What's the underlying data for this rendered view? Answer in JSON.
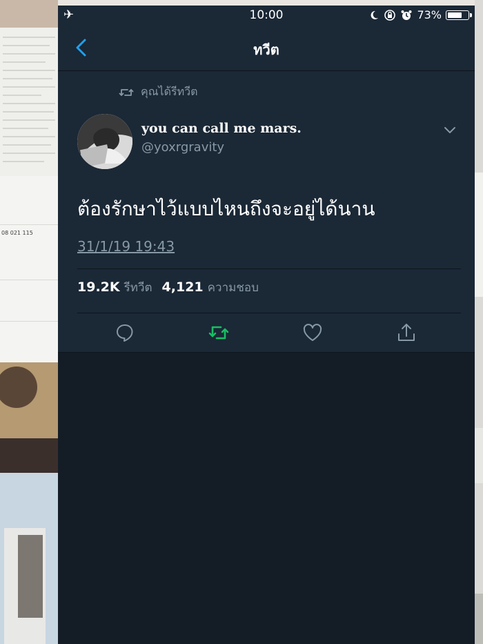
{
  "status_bar": {
    "time": "10:00",
    "battery_percent_text": "73%",
    "battery_level": 0.73,
    "icons": [
      "airplane-icon",
      "moon-icon",
      "rotation-lock-icon",
      "alarm-icon",
      "battery-icon"
    ]
  },
  "nav": {
    "title": "ทวีต",
    "back_icon": "chevron-left-icon"
  },
  "tweet": {
    "retweet_context": "คุณได้รีทวีต",
    "display_name": "you can call me mars.",
    "handle": "@yoxrgravity",
    "text": "ต้องรักษาไว้แบบไหนถึงจะอยู่ได้นาน",
    "timestamp": "31/1/19 19:43",
    "retweets_count": "19.2K",
    "retweets_label": "รีทวีต",
    "likes_count": "4,121",
    "likes_label": "ความชอบ",
    "retweeted": true
  },
  "actions": [
    {
      "name": "reply",
      "icon": "reply-icon"
    },
    {
      "name": "retweet",
      "icon": "retweet-icon"
    },
    {
      "name": "like",
      "icon": "heart-icon"
    },
    {
      "name": "share",
      "icon": "share-icon"
    }
  ],
  "background_texts": {
    "phone_number": "08 021 115"
  },
  "colors": {
    "background": "#141d26",
    "card": "#1b2836",
    "secondary_text": "#8899a6",
    "accent_blue": "#1da1f2",
    "retweet_green": "#17bf63"
  }
}
